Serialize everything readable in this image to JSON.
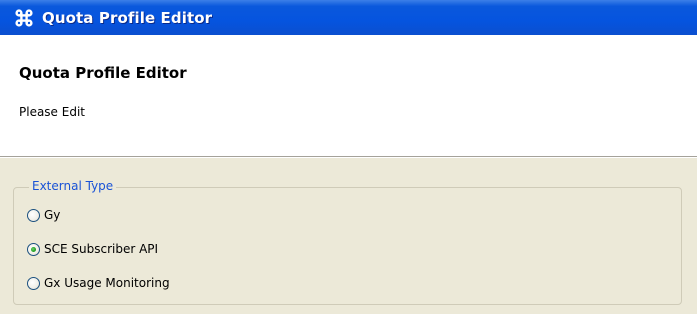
{
  "window": {
    "title": "Quota Profile Editor",
    "icon": "editor-command-icon"
  },
  "header": {
    "title": "Quota Profile Editor",
    "subtitle": "Please Edit"
  },
  "external_type": {
    "legend": "External Type",
    "options": [
      {
        "label": "Gy",
        "selected": false
      },
      {
        "label": "SCE Subscriber API",
        "selected": true
      },
      {
        "label": "Gx Usage Monitoring",
        "selected": false
      }
    ]
  },
  "colors": {
    "titlebar": "#0554df",
    "legend_text": "#1a53d6",
    "panel_bg": "#ece9d8"
  }
}
